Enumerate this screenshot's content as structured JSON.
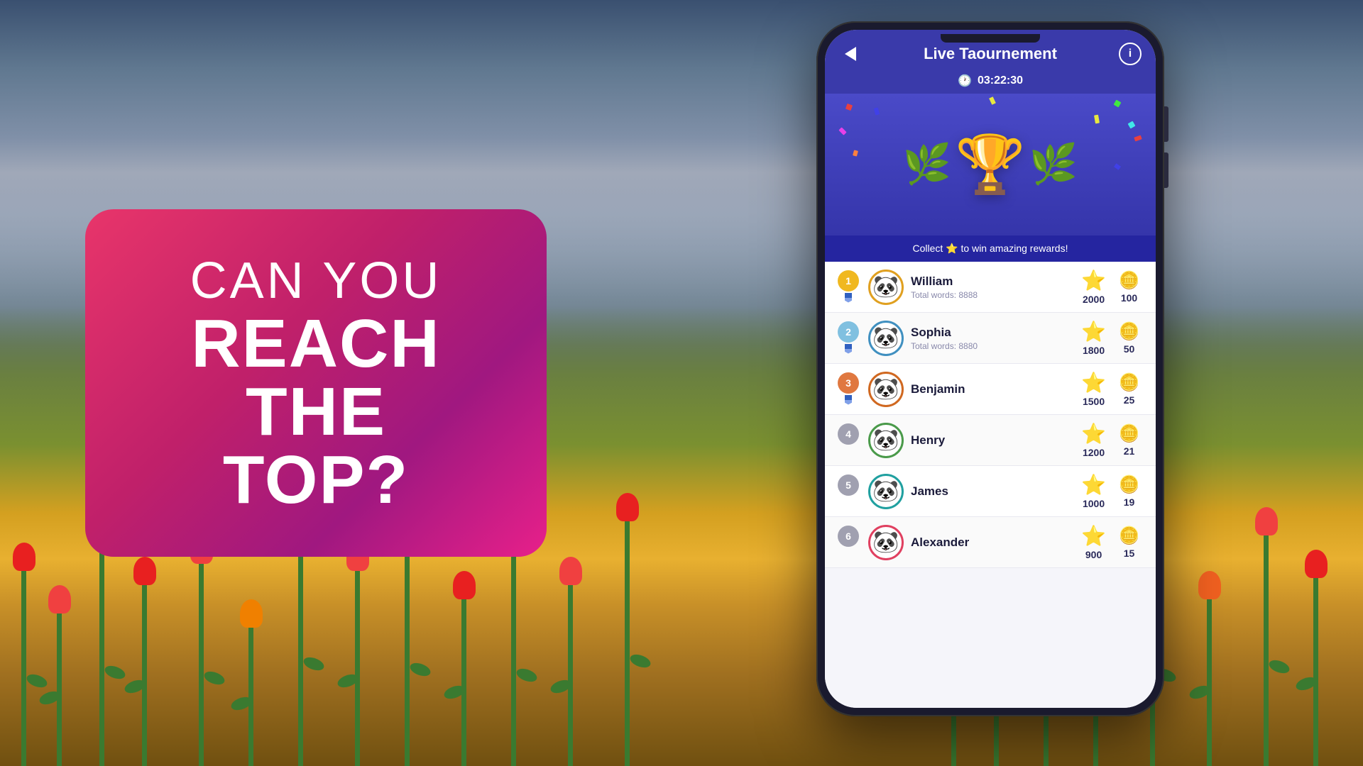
{
  "background": {
    "description": "Tulip field with mountains and cloudy sky"
  },
  "promo": {
    "line1": "CAN YOU",
    "line2": "REACH THE",
    "line3": "TOP?"
  },
  "app": {
    "title": "Live Taournement",
    "timer": "03:22:30",
    "timer_label": "timer",
    "collect_text": "Collect ⭐ to win amazing rewards!",
    "back_label": "←",
    "info_label": "i"
  },
  "leaderboard": [
    {
      "rank": 1,
      "name": "William",
      "words": "Total words: 8888",
      "stars": 2000,
      "coins": 100,
      "avatar": "🐼",
      "ring": "gold"
    },
    {
      "rank": 2,
      "name": "Sophia",
      "words": "Total words: 8880",
      "stars": 1800,
      "coins": 50,
      "avatar": "🐼",
      "ring": "blue"
    },
    {
      "rank": 3,
      "name": "Benjamin",
      "words": "",
      "stars": 1500,
      "coins": 25,
      "avatar": "🐼",
      "ring": "orange"
    },
    {
      "rank": 4,
      "name": "Henry",
      "words": "",
      "stars": 1200,
      "coins": 21,
      "avatar": "🐼",
      "ring": "green"
    },
    {
      "rank": 5,
      "name": "James",
      "words": "",
      "stars": 1000,
      "coins": 19,
      "avatar": "🐼",
      "ring": "teal"
    },
    {
      "rank": 6,
      "name": "Alexander",
      "words": "",
      "stars": 900,
      "coins": 15,
      "avatar": "🐼",
      "ring": "pink"
    }
  ],
  "confetti_colors": [
    "#e84040",
    "#4040e8",
    "#40e840",
    "#e8e840",
    "#e840e8",
    "#40e8e8",
    "#ff8040"
  ]
}
